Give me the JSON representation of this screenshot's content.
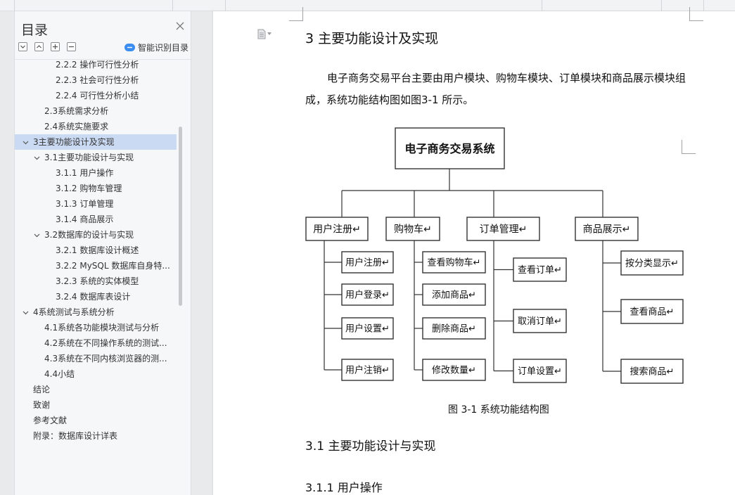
{
  "outline": {
    "title": "目录",
    "smart_toc_label": "智能识别目录",
    "items": [
      {
        "label": "2.2.2 操作可行性分析",
        "level": 3,
        "arrow": ""
      },
      {
        "label": "2.2.3 社会可行性分析",
        "level": 3,
        "arrow": ""
      },
      {
        "label": "2.2.4 可行性分析小结",
        "level": 3,
        "arrow": ""
      },
      {
        "label": "2.3系统需求分析",
        "level": 2,
        "arrow": ""
      },
      {
        "label": "2.4系统实施要求",
        "level": 2,
        "arrow": ""
      },
      {
        "label": "3主要功能设计及实现",
        "level": 1,
        "arrow": "down",
        "active": true
      },
      {
        "label": "3.1主要功能设计与实现",
        "level": 2,
        "arrow": "down"
      },
      {
        "label": "3.1.1 用户操作",
        "level": 3,
        "arrow": ""
      },
      {
        "label": "3.1.2 购物车管理",
        "level": 3,
        "arrow": ""
      },
      {
        "label": "3.1.3 订单管理",
        "level": 3,
        "arrow": ""
      },
      {
        "label": "3.1.4 商品展示",
        "level": 3,
        "arrow": ""
      },
      {
        "label": "3.2数据库的设计与实现",
        "level": 2,
        "arrow": "down"
      },
      {
        "label": "3.2.1 数据库设计概述",
        "level": 3,
        "arrow": ""
      },
      {
        "label": "3.2.2 MySQL 数据库自身特...",
        "level": 3,
        "arrow": ""
      },
      {
        "label": "3.2.3 系统的实体模型",
        "level": 3,
        "arrow": ""
      },
      {
        "label": "3.2.4 数据库表设计",
        "level": 3,
        "arrow": ""
      },
      {
        "label": "4系统测试与系统分析",
        "level": 1,
        "arrow": "down"
      },
      {
        "label": "4.1系统各功能模块测试与分析",
        "level": 2,
        "arrow": ""
      },
      {
        "label": "4.2系统在不同操作系统的测试...",
        "level": 2,
        "arrow": ""
      },
      {
        "label": "4.3系统在不同内核浏览器的测...",
        "level": 2,
        "arrow": ""
      },
      {
        "label": "4.4小结",
        "level": 2,
        "arrow": ""
      },
      {
        "label": "结论",
        "level": 1,
        "arrow": ""
      },
      {
        "label": "致谢",
        "level": 1,
        "arrow": ""
      },
      {
        "label": "参考文献",
        "level": 1,
        "arrow": ""
      },
      {
        "label": "附录：数据库设计详表",
        "level": 1,
        "arrow": ""
      }
    ]
  },
  "document": {
    "heading": "3  主要功能设计及实现",
    "paragraph": "电子商务交易平台主要由用户模块、购物车模块、订单模块和商品展示模块组成，系统功能结构图如图3-1 所示。",
    "figure_caption": "图 3-1 系统功能结构图",
    "subheading": "3.1 主要功能设计与实现",
    "subsubheading": "3.1.1 用户操作"
  },
  "diagram": {
    "root": "电子商务交易系统",
    "modules": [
      {
        "label": "用户注册↵",
        "children": [
          "用户注册↵",
          "用户登录↵",
          "用户设置↵",
          "用户注销↵"
        ]
      },
      {
        "label": "购物车↵",
        "children": [
          "查看购物车↵",
          "添加商品↵",
          "删除商品↵",
          "修改数量↵"
        ]
      },
      {
        "label": "订单管理↵",
        "children": [
          "查看订单↵",
          "取消订单↵",
          "订单设置↵"
        ]
      },
      {
        "label": "商品展示↵",
        "children": [
          "按分类显示↵",
          "查看商品↵",
          "搜索商品↵"
        ]
      }
    ]
  },
  "colors": {
    "active_item": "#cbdaf3",
    "smart_toc_icon": "#3b8df0",
    "diagram_root_text": "#1a1a6e"
  }
}
